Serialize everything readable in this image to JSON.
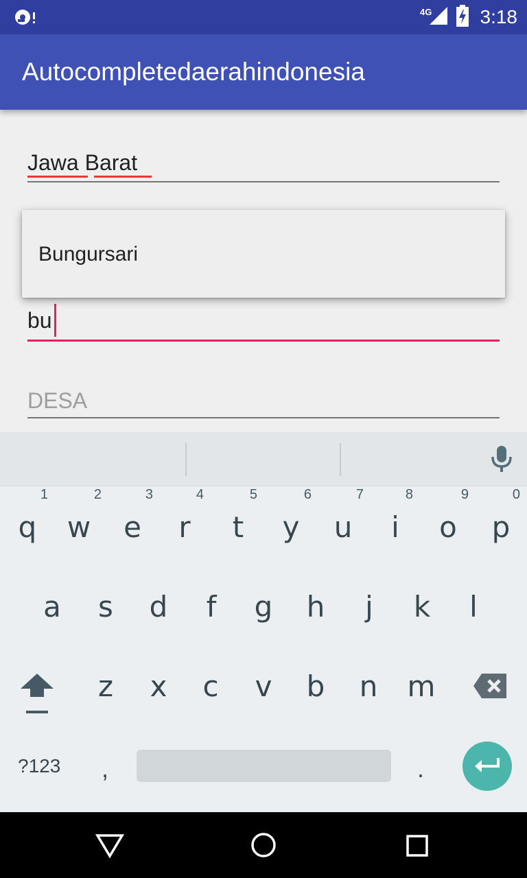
{
  "status_bar": {
    "network": "4G",
    "time": "3:18"
  },
  "app_bar": {
    "title": "Autocompletedaerahindonesia"
  },
  "form": {
    "province_value": "Jawa Barat",
    "city_value": "bu",
    "village_placeholder": "DESA"
  },
  "autocomplete": {
    "suggestions": [
      "Bungursari"
    ]
  },
  "keyboard": {
    "row1": [
      "q",
      "w",
      "e",
      "r",
      "t",
      "y",
      "u",
      "i",
      "o",
      "p"
    ],
    "row1_hints": [
      "1",
      "2",
      "3",
      "4",
      "5",
      "6",
      "7",
      "8",
      "9",
      "0"
    ],
    "row2": [
      "a",
      "s",
      "d",
      "f",
      "g",
      "h",
      "j",
      "k",
      "l"
    ],
    "row3": [
      "z",
      "x",
      "c",
      "v",
      "b",
      "n",
      "m"
    ],
    "symbols_key": "?123",
    "comma_key": ",",
    "period_key": "."
  },
  "colors": {
    "primary": "#3f51b5",
    "primary_dark": "#303f9f",
    "accent": "#e91e63",
    "enter_key": "#4db6ac"
  },
  "icons": {
    "status_left": "notification-icon",
    "signal": "signal-icon",
    "battery": "battery-charging-icon",
    "mic": "mic-icon",
    "shift": "shift-icon",
    "backspace": "backspace-icon",
    "enter": "enter-icon",
    "back": "back-icon",
    "home": "home-icon",
    "recents": "recents-icon"
  }
}
